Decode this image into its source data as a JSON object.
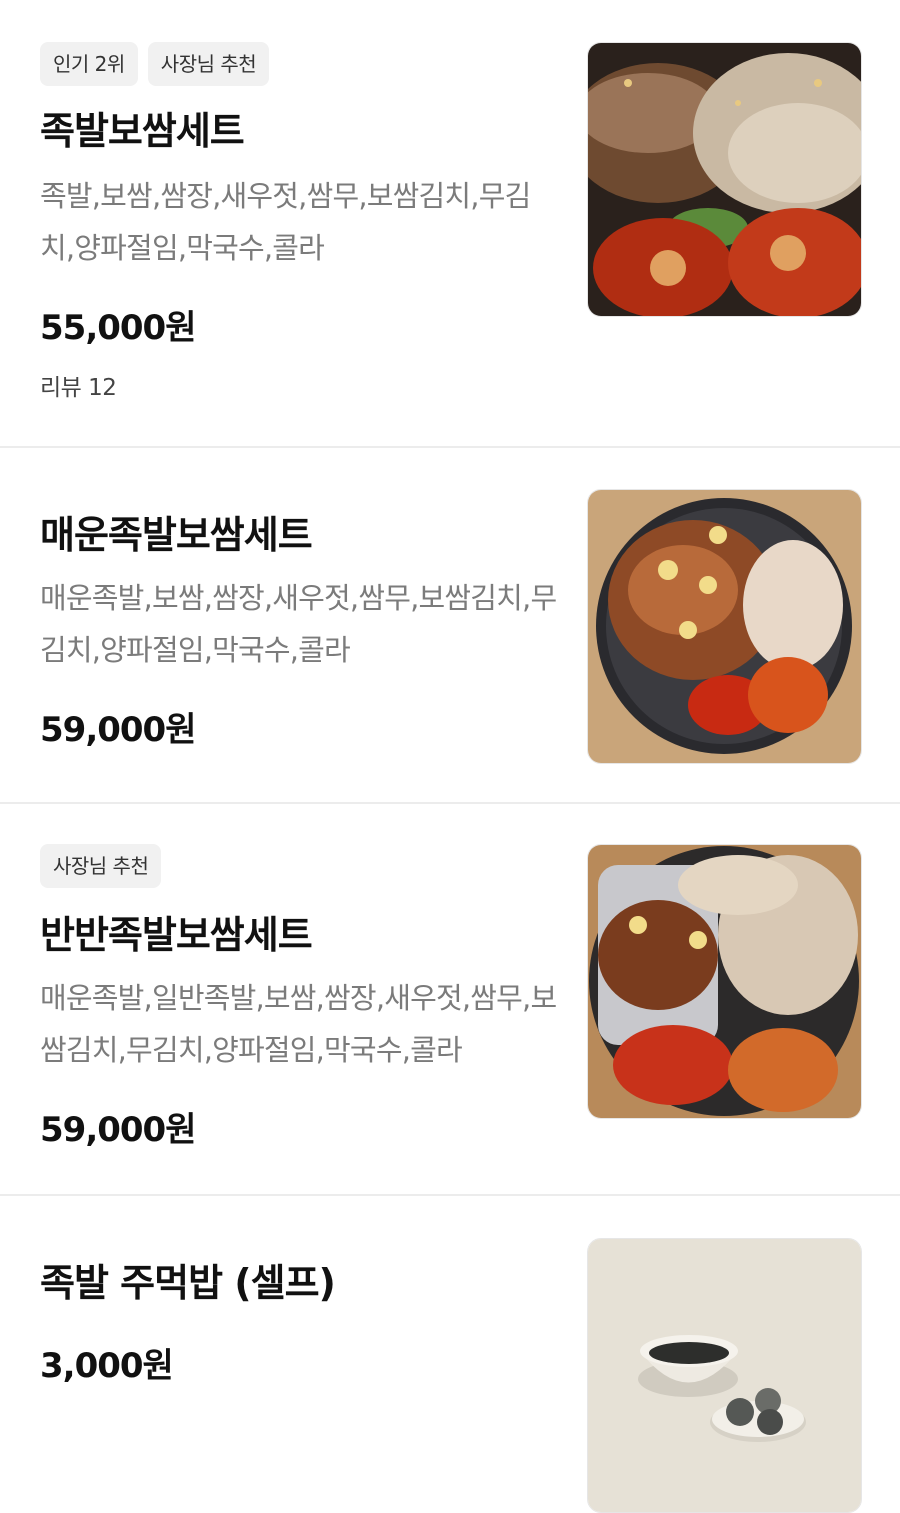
{
  "menu": {
    "items": [
      {
        "badges": [
          "인기 2위",
          "사장님 추천"
        ],
        "name": "족발보쌈세트",
        "description": "족발,보쌈,쌈장,새우젓,쌈무,보쌈김치,무김치,양파절임,막국수,콜라",
        "price": "55,000원",
        "review": "리뷰 12",
        "image_icon": "jokbal-bossam-photo"
      },
      {
        "name": "매운족발보쌈세트",
        "description": "매운족발,보쌈,쌈장,새우젓,쌈무,보쌈김치,무김치,양파절임,막국수,콜라",
        "price": "59,000원",
        "image_icon": "spicy-jokbal-photo"
      },
      {
        "badges": [
          "사장님 추천"
        ],
        "name": "반반족발보쌈세트",
        "description": "매운족발,일반족발,보쌈,쌈장,새우젓,쌈무,보쌈김치,무김치,양파절임,막국수,콜라",
        "price": "59,000원",
        "image_icon": "half-half-jokbal-photo"
      },
      {
        "name": "족발 주먹밥 (셀프)",
        "price": "3,000원",
        "image_icon": "rice-ball-photo"
      }
    ]
  },
  "colors": {
    "badge_bg": "#f1f1f1",
    "description_text": "#7b7b7b",
    "divider": "#ececec"
  }
}
